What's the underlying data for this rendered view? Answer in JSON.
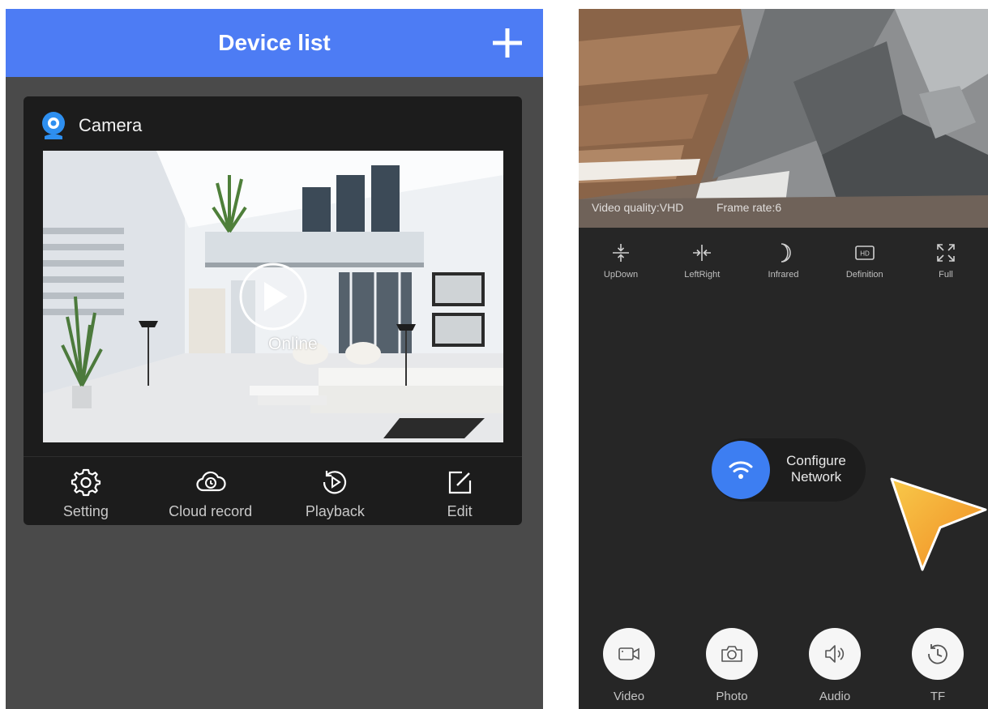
{
  "left": {
    "header": {
      "title": "Device list",
      "add_icon": "plus-icon"
    },
    "device": {
      "name": "Camera",
      "status": "Online",
      "actions": [
        {
          "label": "Setting",
          "icon": "gear-icon"
        },
        {
          "label": "Cloud record",
          "icon": "cloud-clock-icon"
        },
        {
          "label": "Playback",
          "icon": "playback-icon"
        },
        {
          "label": "Edit",
          "icon": "edit-icon"
        }
      ]
    },
    "colors": {
      "header": "#4d7cf4",
      "background": "#4a4a4a",
      "card": "#1c1c1c"
    }
  },
  "right": {
    "overlay": {
      "quality": "Video quality:VHD",
      "frame_rate": "Frame rate:6"
    },
    "controls": [
      {
        "label": "UpDown",
        "icon": "flip-vertical-icon"
      },
      {
        "label": "LeftRight",
        "icon": "flip-horizontal-icon"
      },
      {
        "label": "Infrared",
        "icon": "moon-icon"
      },
      {
        "label": "Definition",
        "icon": "hd-icon"
      },
      {
        "label": "Full",
        "icon": "fullscreen-icon"
      }
    ],
    "configure": {
      "line1": "Configure",
      "line2": "Network",
      "icon": "wifi-icon"
    },
    "bottom": [
      {
        "label": "Video",
        "icon": "video-camera-icon"
      },
      {
        "label": "Photo",
        "icon": "camera-icon"
      },
      {
        "label": "Audio",
        "icon": "speaker-icon"
      },
      {
        "label": "TF",
        "icon": "history-icon"
      }
    ],
    "colors": {
      "background": "#262626",
      "wifi": "#3d7ef2",
      "pointer": "#f7a531"
    }
  }
}
